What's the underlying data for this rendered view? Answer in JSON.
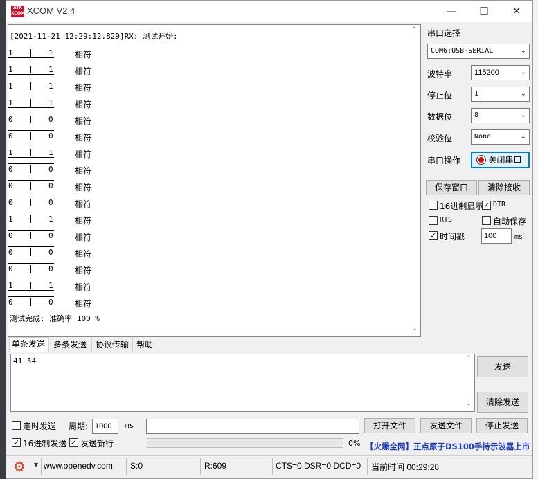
{
  "window": {
    "title": "XCOM V2.4",
    "logo_text": "ATK XCOM",
    "minimize": "—",
    "maximize": "☐",
    "close": "✕"
  },
  "receive": {
    "header": "[2021-11-21 12:29:12.829]RX: 测试开始:",
    "rows": [
      {
        "a": "1",
        "b": "1",
        "r": "相符"
      },
      {
        "a": "1",
        "b": "1",
        "r": "相符"
      },
      {
        "a": "1",
        "b": "1",
        "r": "相符"
      },
      {
        "a": "1",
        "b": "1",
        "r": "相符"
      },
      {
        "a": "0",
        "b": "0",
        "r": "相符"
      },
      {
        "a": "0",
        "b": "0",
        "r": "相符"
      },
      {
        "a": "1",
        "b": "1",
        "r": "相符"
      },
      {
        "a": "0",
        "b": "0",
        "r": "相符"
      },
      {
        "a": "0",
        "b": "0",
        "r": "相符"
      },
      {
        "a": "0",
        "b": "0",
        "r": "相符"
      },
      {
        "a": "1",
        "b": "1",
        "r": "相符"
      },
      {
        "a": "0",
        "b": "0",
        "r": "相符"
      },
      {
        "a": "0",
        "b": "0",
        "r": "相符"
      },
      {
        "a": "0",
        "b": "0",
        "r": "相符"
      },
      {
        "a": "1",
        "b": "1",
        "r": "相符"
      },
      {
        "a": "0",
        "b": "0",
        "r": "相符"
      }
    ],
    "footer": "测试完成: 准确率 100 %"
  },
  "panel": {
    "port_select_label": "串口选择",
    "port_value": "COM6:USB-SERIAL",
    "baud_label": "波特率",
    "baud_value": "115200",
    "stop_label": "停止位",
    "stop_value": "1",
    "data_label": "数据位",
    "data_value": "8",
    "parity_label": "校验位",
    "parity_value": "None",
    "op_label": "串口操作",
    "close_port_button": "关闭串口",
    "save_window_button": "保存窗口",
    "clear_recv_button": "清除接收",
    "hex_display_label": "16进制显示",
    "hex_display_checked": false,
    "dtr_label": "DTR",
    "dtr_checked": true,
    "rts_label": "RTS",
    "rts_checked": false,
    "autosave_label": "自动保存",
    "autosave_checked": false,
    "timestamp_label": "时间戳",
    "timestamp_checked": true,
    "timestamp_value": "100",
    "timestamp_unit": "ms"
  },
  "tabs": [
    "单条发送",
    "多条发送",
    "协议传输",
    "帮助"
  ],
  "send": {
    "text": "41 54",
    "send_button": "发送",
    "clear_send_button": "清除发送",
    "timed_send_label": "定时发送",
    "timed_send_checked": false,
    "period_label": "周期:",
    "period_value": "1000",
    "period_unit": "ms",
    "hex_send_label": "16进制发送",
    "hex_send_checked": true,
    "newline_label": "发送新行",
    "newline_checked": true,
    "open_file_button": "打开文件",
    "send_file_button": "发送文件",
    "stop_send_button": "停止发送",
    "progress_percent": 0,
    "progress_text": "0%",
    "ad_text": "【火爆全网】正点原子DS100手持示波器上市"
  },
  "status": {
    "url": "www.openedv.com",
    "sent": "S:0",
    "received": "R:609",
    "lines": "CTS=0 DSR=0 DCD=0",
    "time": "当前时间 00:29:28"
  },
  "colors": {
    "accent": "#0078d7",
    "gear": "#d9411e",
    "ad": "#1f3fbf",
    "close_dot": "#e00000"
  },
  "icons": {
    "gear": "gear-icon",
    "close_port": "record-icon",
    "caret": "caret-down-icon"
  }
}
